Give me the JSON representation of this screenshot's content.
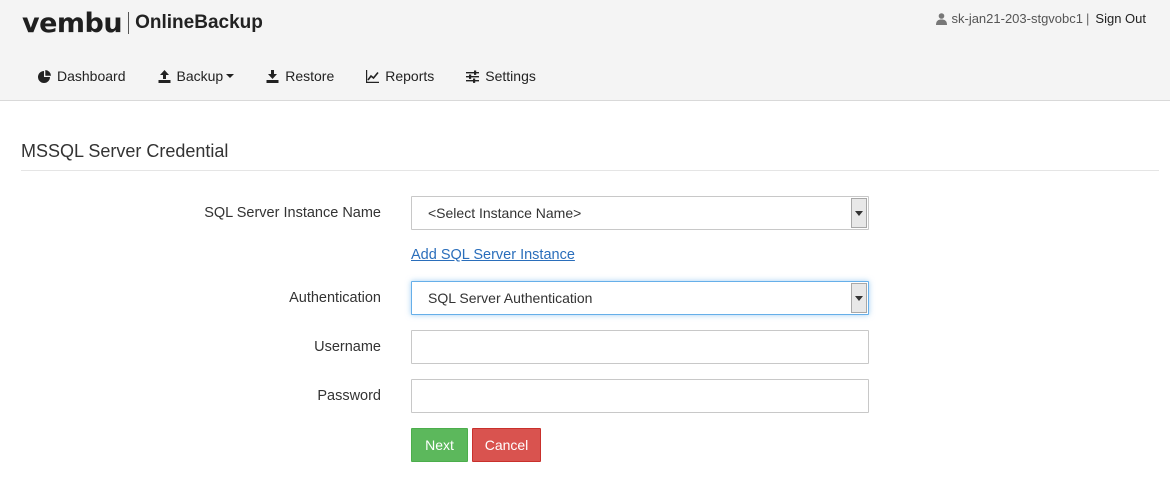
{
  "header": {
    "logo_brand": "vembu",
    "logo_product": "OnlineBackup",
    "username": "sk-jan21-203-stgvobc1",
    "separator": "|",
    "signout_label": "Sign Out"
  },
  "nav": {
    "items": [
      {
        "label": "Dashboard",
        "icon": "pie-chart-icon"
      },
      {
        "label": "Backup",
        "icon": "upload-icon",
        "has_dropdown": true
      },
      {
        "label": "Restore",
        "icon": "download-icon"
      },
      {
        "label": "Reports",
        "icon": "line-chart-icon"
      },
      {
        "label": "Settings",
        "icon": "sliders-icon"
      }
    ]
  },
  "form": {
    "title": "MSSQL Server Credential",
    "instance_label": "SQL Server Instance Name",
    "instance_value": "<Select Instance Name>",
    "add_instance_link": "Add SQL Server Instance",
    "auth_label": "Authentication",
    "auth_value": "SQL Server Authentication",
    "username_label": "Username",
    "username_value": "",
    "password_label": "Password",
    "password_value": "",
    "next_label": "Next",
    "cancel_label": "Cancel"
  },
  "colors": {
    "header_bg": "#f4f4f4",
    "link": "#2a6ebb",
    "next_button": "#5cb85c",
    "cancel_button": "#d9534f",
    "focus_border": "#66afe9"
  }
}
